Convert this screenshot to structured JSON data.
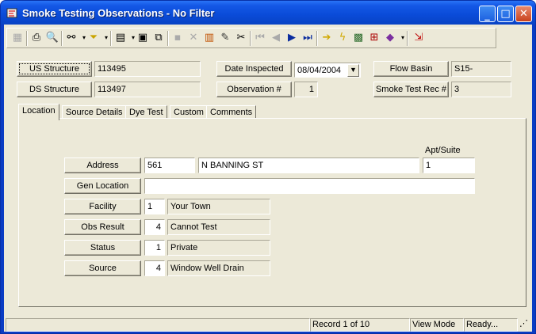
{
  "window": {
    "title": "Smoke Testing Observations - No Filter"
  },
  "toolbar": {
    "icons": [
      "grid-icon",
      "print-icon",
      "print-preview-icon",
      "binoculars-icon",
      "filter-icon",
      "report-icon",
      "properties-icon",
      "copy-icon",
      "save-icon",
      "delete-icon",
      "books-icon",
      "edit-pencil-icon",
      "cut-icon",
      "first-record-icon",
      "previous-record-icon",
      "next-record-icon",
      "last-record-icon",
      "goto-icon",
      "lightning-icon",
      "map-icon",
      "tree-icon",
      "book-icon",
      "exit-icon"
    ]
  },
  "header": {
    "us_structure": {
      "label": "US Structure",
      "value": "113495"
    },
    "ds_structure": {
      "label": "DS Structure",
      "value": "113497"
    },
    "date_inspected": {
      "label": "Date Inspected",
      "value": "08/04/2004"
    },
    "observation": {
      "label": "Observation #",
      "value": "1"
    },
    "flow_basin": {
      "label": "Flow Basin",
      "value": "S15-"
    },
    "smoke_test_rec": {
      "label": "Smoke Test Rec #",
      "value": "3"
    }
  },
  "tabs": [
    {
      "label": "Location",
      "active": true
    },
    {
      "label": "Source Details",
      "active": false
    },
    {
      "label": "Dye Test",
      "active": false
    },
    {
      "label": "Custom",
      "active": false
    },
    {
      "label": "Comments",
      "active": false
    }
  ],
  "location": {
    "apt_suite_label": "Apt/Suite",
    "address": {
      "label": "Address",
      "number": "561",
      "street": "N BANNING ST",
      "apt": "1"
    },
    "gen_location": {
      "label": "Gen Location",
      "value": ""
    },
    "facility": {
      "label": "Facility",
      "code": "1",
      "desc": "Your Town"
    },
    "obs_result": {
      "label": "Obs Result",
      "code": "4",
      "desc": "Cannot Test"
    },
    "status": {
      "label": "Status",
      "code": "1",
      "desc": "Private"
    },
    "source": {
      "label": "Source",
      "code": "4",
      "desc": "Window Well Drain"
    }
  },
  "statusbar": {
    "record": "Record 1 of 10",
    "mode": "View Mode",
    "state": "Ready..."
  },
  "colors": {
    "title_bar": "#0a4bd8",
    "face": "#ece9d8"
  }
}
